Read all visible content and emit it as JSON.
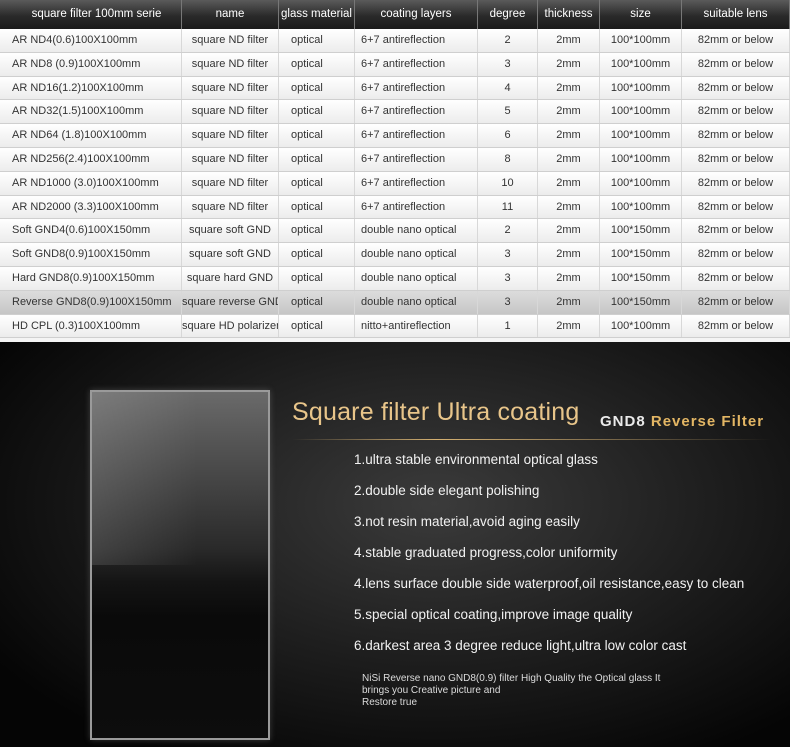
{
  "table": {
    "headers": [
      "square filter 100mm serie",
      "name",
      "glass material",
      "coating layers",
      "degree",
      "thickness",
      "size",
      "suitable lens"
    ],
    "rows": [
      [
        "AR ND4(0.6)100X100mm",
        "square ND filter",
        "optical",
        "6+7 antireflection",
        "2",
        "2mm",
        "100*100mm",
        "82mm or below"
      ],
      [
        "AR ND8 (0.9)100X100mm",
        "square ND filter",
        "optical",
        "6+7 antireflection",
        "3",
        "2mm",
        "100*100mm",
        "82mm or below"
      ],
      [
        "AR ND16(1.2)100X100mm",
        "square ND filter",
        "optical",
        "6+7 antireflection",
        "4",
        "2mm",
        "100*100mm",
        "82mm or below"
      ],
      [
        "AR ND32(1.5)100X100mm",
        "square ND filter",
        "optical",
        "6+7 antireflection",
        "5",
        "2mm",
        "100*100mm",
        "82mm or below"
      ],
      [
        "AR ND64 (1.8)100X100mm",
        "square ND filter",
        "optical",
        "6+7 antireflection",
        "6",
        "2mm",
        "100*100mm",
        "82mm or below"
      ],
      [
        "AR ND256(2.4)100X100mm",
        "square ND filter",
        "optical",
        "6+7 antireflection",
        "8",
        "2mm",
        "100*100mm",
        "82mm or below"
      ],
      [
        "AR ND1000 (3.0)100X100mm",
        "square ND filter",
        "optical",
        "6+7 antireflection",
        "10",
        "2mm",
        "100*100mm",
        "82mm or below"
      ],
      [
        "AR ND2000 (3.3)100X100mm",
        "square ND filter",
        "optical",
        "6+7 antireflection",
        "11",
        "2mm",
        "100*100mm",
        "82mm or below"
      ],
      [
        "Soft GND4(0.6)100X150mm",
        "square soft GND",
        "optical",
        "double nano optical",
        "2",
        "2mm",
        "100*150mm",
        "82mm or below"
      ],
      [
        "Soft GND8(0.9)100X150mm",
        "square soft GND",
        "optical",
        "double nano optical",
        "3",
        "2mm",
        "100*150mm",
        "82mm or below"
      ],
      [
        "Hard GND8(0.9)100X150mm",
        "square hard GND",
        "optical",
        "double nano optical",
        "3",
        "2mm",
        "100*150mm",
        "82mm or below"
      ],
      [
        "Reverse GND8(0.9)100X150mm",
        "square reverse GND",
        "optical",
        "double nano optical",
        "3",
        "2mm",
        "100*150mm",
        "82mm or below"
      ],
      [
        "HD CPL (0.3)100X100mm",
        "square HD polarizer",
        "optical",
        "nitto+antireflection",
        "1",
        "2mm",
        "100*100mm",
        "82mm or below"
      ]
    ],
    "highlight_row": 11
  },
  "promo": {
    "headline": "Square filter  Ultra coating",
    "badge_part1": "GND8",
    "badge_part2": "Reverse Filter",
    "features": [
      "1.ultra stable environmental optical glass",
      "2.double side elegant polishing",
      "3.not resin material,avoid aging easily",
      "4.stable graduated progress,color uniformity",
      "4.lens surface double side waterproof,oil resistance,easy to clean",
      "5.special optical coating,improve image quality",
      "6.darkest area 3 degree reduce light,ultra low color cast"
    ],
    "description_lines": [
      "NiSi Reverse nano GND8(0.9) filter High Quality the Optical glass It",
      "brings you Creative picture and",
      "Restore true"
    ]
  },
  "colors": {
    "headline_gold": "#e8c58a",
    "badge_gold": "#e3b664",
    "header_bar": "#2a2a2a"
  }
}
